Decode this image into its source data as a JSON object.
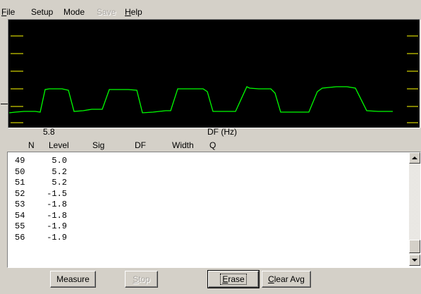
{
  "menu": {
    "file": {
      "mnemonic": "F",
      "rest": "ile"
    },
    "setup": "Setup",
    "mode": "Mode",
    "save": "Save",
    "help": {
      "mnemonic": "H",
      "rest": "elp"
    }
  },
  "plot": {
    "background": "#000000",
    "trace_color": "#00ff00",
    "tick_color": "#ffff00",
    "readout_value": "5.8",
    "axis_label": "DF (Hz)"
  },
  "table": {
    "columns": [
      "N",
      "Level",
      "Sig",
      "DF",
      "Width",
      "Q"
    ],
    "rows": [
      {
        "n": "49",
        "level": "5.0"
      },
      {
        "n": "50",
        "level": "5.2"
      },
      {
        "n": "51",
        "level": "5.2"
      },
      {
        "n": "52",
        "level": "-1.5"
      },
      {
        "n": "53",
        "level": "-1.8"
      },
      {
        "n": "54",
        "level": "-1.8"
      },
      {
        "n": "55",
        "level": "-1.9"
      },
      {
        "n": "56",
        "level": "-1.9"
      }
    ]
  },
  "buttons": {
    "measure": "Measure",
    "stop": {
      "mnemonic": "S",
      "rest": "top"
    },
    "erase": {
      "mnemonic": "E",
      "rest": "rase"
    },
    "clear_avg": {
      "mnemonic": "C",
      "rest": "lear Avg"
    }
  }
}
